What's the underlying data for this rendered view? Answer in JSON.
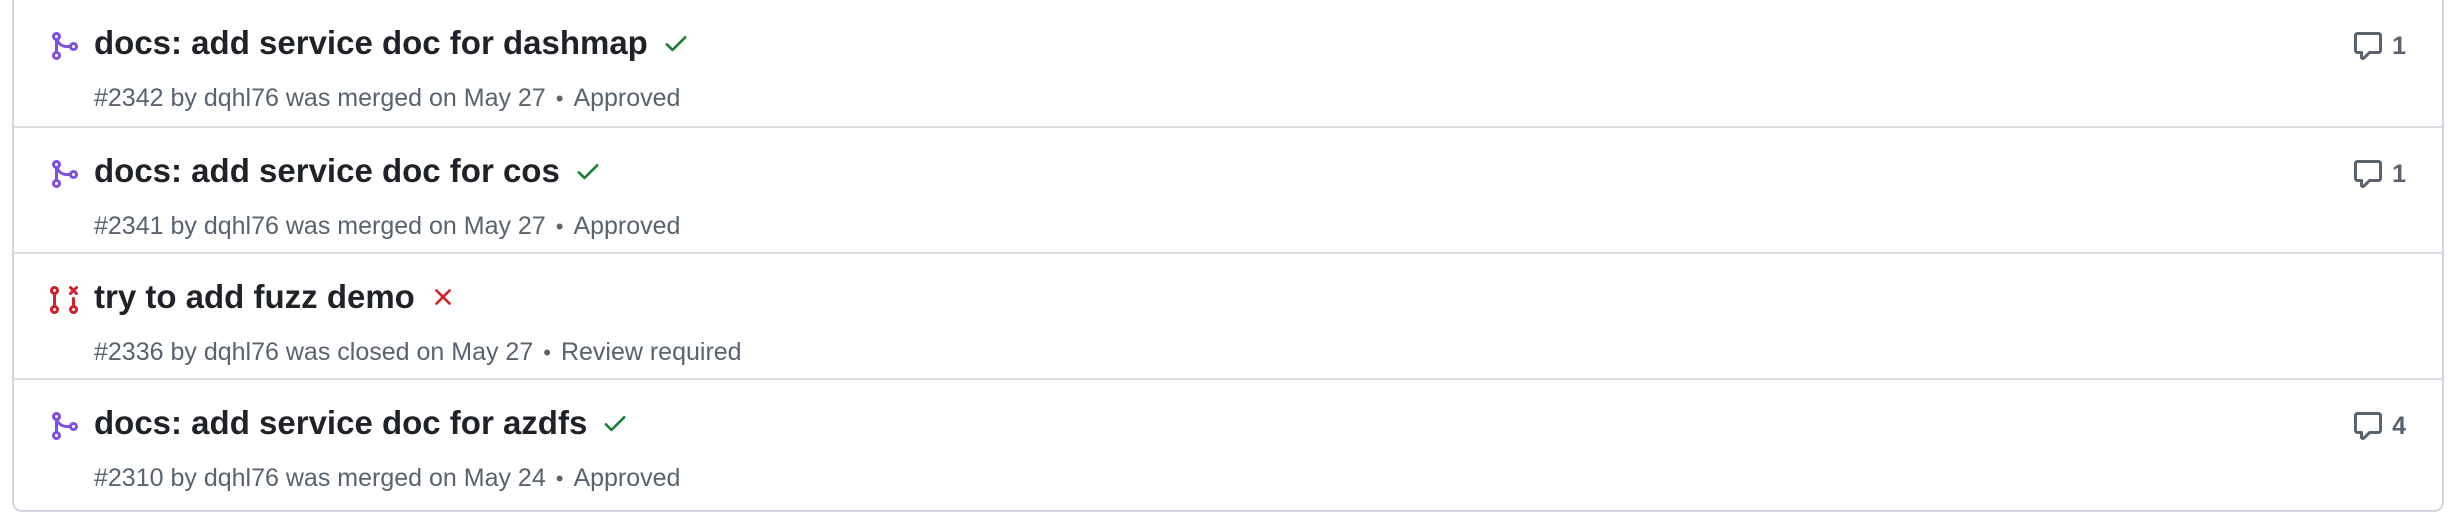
{
  "colors": {
    "merged": "#8250df",
    "closed": "#cf222e",
    "success": "#1a7f37",
    "failure": "#cf222e",
    "muted": "#59636e"
  },
  "pull_requests": [
    {
      "state_icon": "git-merge-icon",
      "title": "docs: add service doc for dashmap",
      "status_icon": "check-icon",
      "number": "#2342",
      "by": "by",
      "author": "dqhl76",
      "action": "was merged on May 27",
      "review": "Approved",
      "comment_icon": "comment-icon",
      "comments": "1"
    },
    {
      "state_icon": "git-merge-icon",
      "title": "docs: add service doc for cos",
      "status_icon": "check-icon",
      "number": "#2341",
      "by": "by",
      "author": "dqhl76",
      "action": "was merged on May 27",
      "review": "Approved",
      "comment_icon": "comment-icon",
      "comments": "1"
    },
    {
      "state_icon": "git-pull-request-closed-icon",
      "title": "try to add fuzz demo",
      "status_icon": "x-icon",
      "number": "#2336",
      "by": "by",
      "author": "dqhl76",
      "action": "was closed on May 27",
      "review": "Review required",
      "comment_icon": "",
      "comments": ""
    },
    {
      "state_icon": "git-merge-icon",
      "title": "docs: add service doc for azdfs",
      "status_icon": "check-icon",
      "number": "#2310",
      "by": "by",
      "author": "dqhl76",
      "action": "was merged on May 24",
      "review": "Approved",
      "comment_icon": "comment-icon",
      "comments": "4"
    }
  ]
}
